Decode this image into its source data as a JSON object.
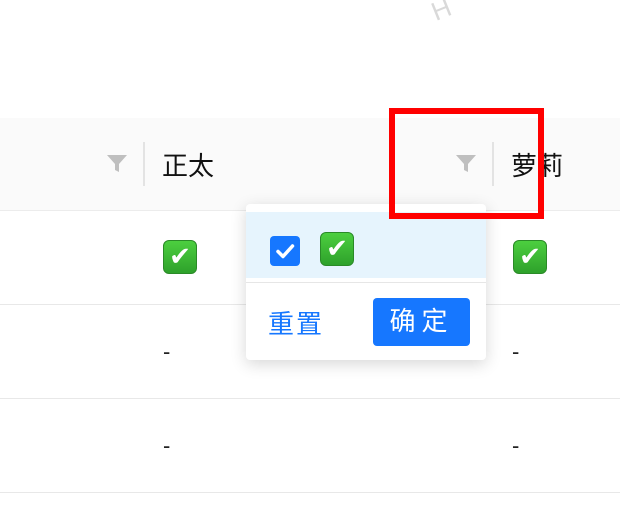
{
  "watermark": "H",
  "table": {
    "columns": [
      {
        "title": "",
        "filter_icon": "filter-icon"
      },
      {
        "title": "正太",
        "filter_icon": "filter-icon"
      },
      {
        "title": "萝莉",
        "filter_icon": "filter-icon"
      }
    ],
    "rows": [
      {
        "col2": "✔",
        "col3": "✔"
      },
      {
        "col2": "-",
        "col3": "-"
      },
      {
        "col2": "-",
        "col3": "-"
      }
    ]
  },
  "filter_dropdown": {
    "option_checked": true,
    "option_label": "✔",
    "reset_label": "重置",
    "confirm_label": "确定"
  },
  "colors": {
    "primary": "#1677ff",
    "option_bg": "#e6f4fd",
    "highlight": "#ff0000",
    "header_bg": "#fafafa"
  }
}
